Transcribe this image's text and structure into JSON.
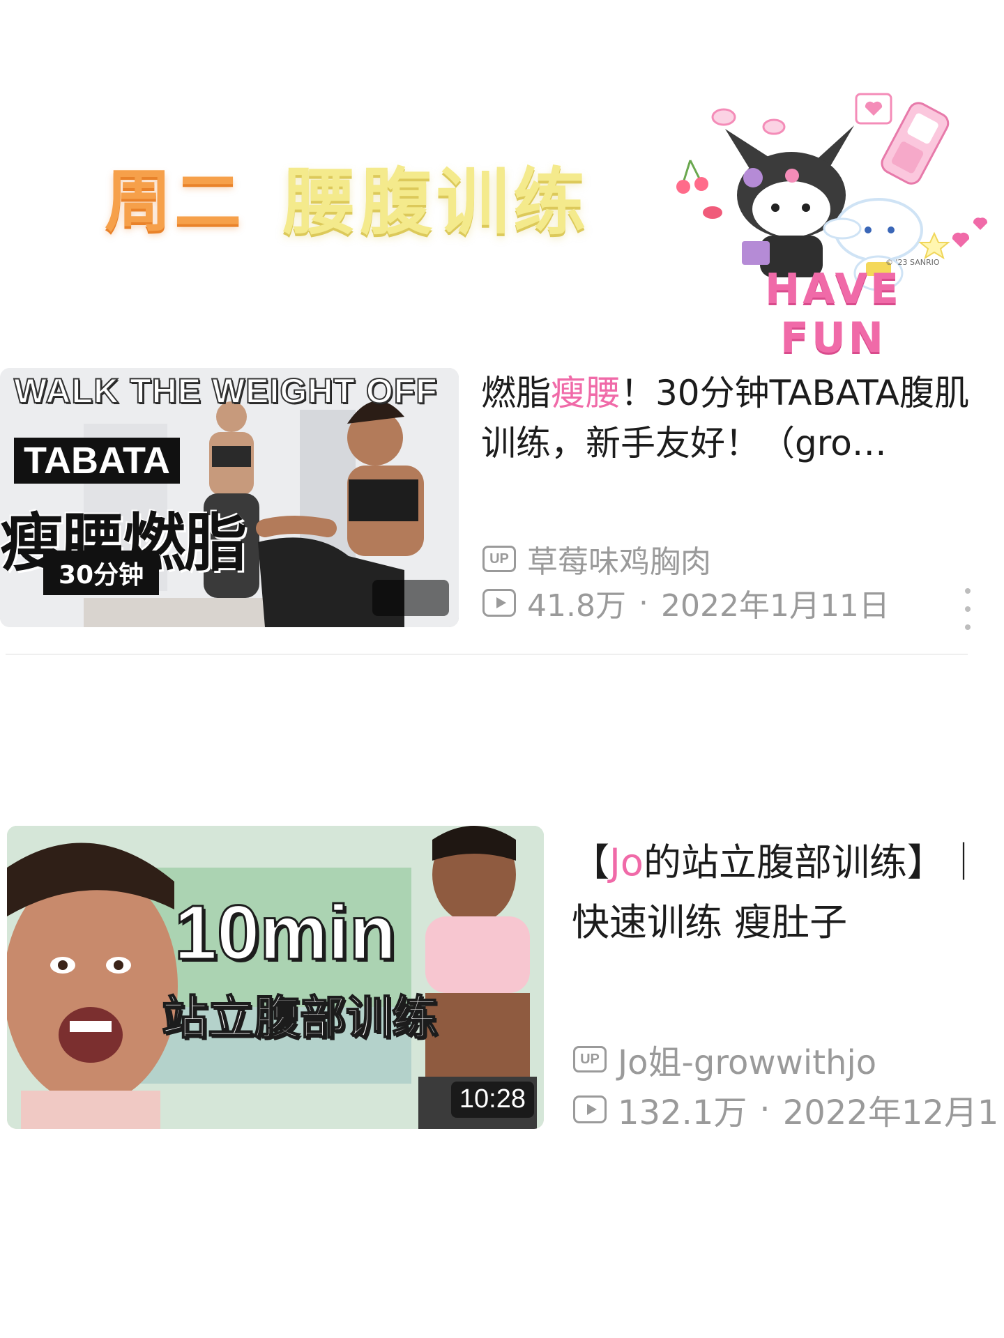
{
  "header": {
    "day": "周二",
    "topic": "腰腹训练",
    "sticker_text": "HAVE FUN",
    "sticker_copyright": "© '23 SANRIO"
  },
  "videos": [
    {
      "thumbnail": {
        "banner": "WALK THE WEIGHT OFF",
        "tag": "TABATA",
        "big_text": "瘦腰燃脂",
        "sub_text": "30分钟",
        "duration": ""
      },
      "title_prefix": "燃脂",
      "title_highlight": "瘦腰",
      "title_suffix": "！30分钟TABATA腹肌训练，新手友好！（gro…",
      "uploader": "草莓味鸡胸肉",
      "views": "41.8万",
      "date": "2022年1月11日"
    },
    {
      "thumbnail": {
        "big_text": "10min",
        "sub_text": "站立腹部训练",
        "duration": "10:28"
      },
      "title_prefix": "【",
      "title_highlight": "Jo",
      "title_suffix": "的站立腹部训练】｜快速训练 瘦肚子",
      "uploader": "Jo姐-growwithjo",
      "views": "132.1万",
      "date": "2022年12月1"
    }
  ],
  "icons": {
    "uploader": "up-icon",
    "views": "play-icon",
    "more": "more-vertical-icon"
  },
  "colors": {
    "highlight": "#f06aa8",
    "meta_text": "#9a9a9a",
    "title_day": "#f6a04a",
    "title_topic": "#f4ea8c"
  }
}
